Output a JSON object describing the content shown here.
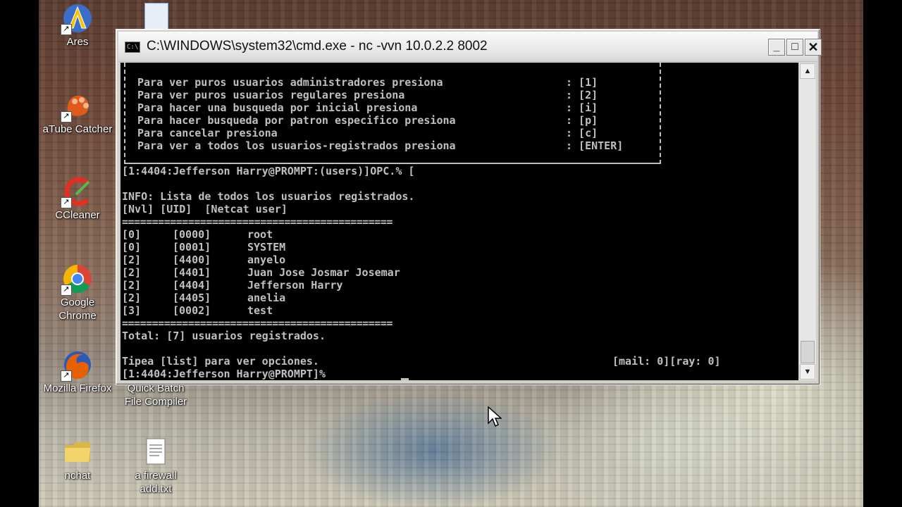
{
  "desktop": {
    "icons": [
      {
        "label": "Ares",
        "icon": "ares-icon",
        "color": "#3a6ec8"
      },
      {
        "label": "aTube Catcher",
        "icon": "atube-catcher-icon",
        "color": "#e05a1c"
      },
      {
        "label": "CCleaner",
        "icon": "ccleaner-icon",
        "color": "#e03020"
      },
      {
        "label": "Google\nChrome",
        "icon": "chrome-icon",
        "color": "#4285f4"
      },
      {
        "label": "Mozilla Firefox",
        "icon": "firefox-icon",
        "color": "#e66000"
      },
      {
        "label": "Quick Batch\nFile Compiler",
        "icon": "quick-batch-compiler-icon",
        "color": "#6b8fd6"
      },
      {
        "label": "nchat",
        "icon": "folder-icon",
        "color": "#f2d46a"
      },
      {
        "label": "a firewall\nadd.txt",
        "icon": "text-file-icon",
        "color": "#ffffff"
      }
    ]
  },
  "window": {
    "title": "C:\\WINDOWS\\system32\\cmd.exe - nc -vvn 10.0.2.2 8002",
    "icon_text": "C:\\",
    "minimize": "_",
    "maximize": "□",
    "close": "✕"
  },
  "console": {
    "menu": [
      {
        "text": "Para ver puros usuarios administradores presiona",
        "key": ": [1]"
      },
      {
        "text": "Para ver puros usuarios regulares presiona",
        "key": ": [2]"
      },
      {
        "text": "Para hacer una busqueda por inicial presiona",
        "key": ": [i]"
      },
      {
        "text": "Para hacer busqueda por patron especifico presiona",
        "key": ": [p]"
      },
      {
        "text": "Para cancelar presiona",
        "key": ": [c]"
      },
      {
        "text": "Para ver a todos los usuarios-registrados presiona",
        "key": ": [ENTER]"
      }
    ],
    "prompt1": "[1:4404:Jefferson Harry@PROMPT:(users)]OPC.% [",
    "info": "INFO: Lista de todos los usuarios registrados.",
    "header": "[Nvl] [UID]  [Netcat user]",
    "separator": "=============================================",
    "users": [
      {
        "nvl": "[0]",
        "uid": "[0000]",
        "name": "root"
      },
      {
        "nvl": "[0]",
        "uid": "[0001]",
        "name": "SYSTEM"
      },
      {
        "nvl": "[2]",
        "uid": "[4400]",
        "name": "anyelo"
      },
      {
        "nvl": "[2]",
        "uid": "[4401]",
        "name": "Juan Jose Josmar Josemar"
      },
      {
        "nvl": "[2]",
        "uid": "[4404]",
        "name": "Jefferson Harry"
      },
      {
        "nvl": "[2]",
        "uid": "[4405]",
        "name": "anelia"
      },
      {
        "nvl": "[3]",
        "uid": "[0002]",
        "name": "test"
      }
    ],
    "total": "Total: [7] usuarios registrados.",
    "hint": "Tipea [list] para ver opciones.",
    "status": "[mail: 0][ray: 0]",
    "prompt2": "[1:4404:Jefferson Harry@PROMPT]%"
  }
}
